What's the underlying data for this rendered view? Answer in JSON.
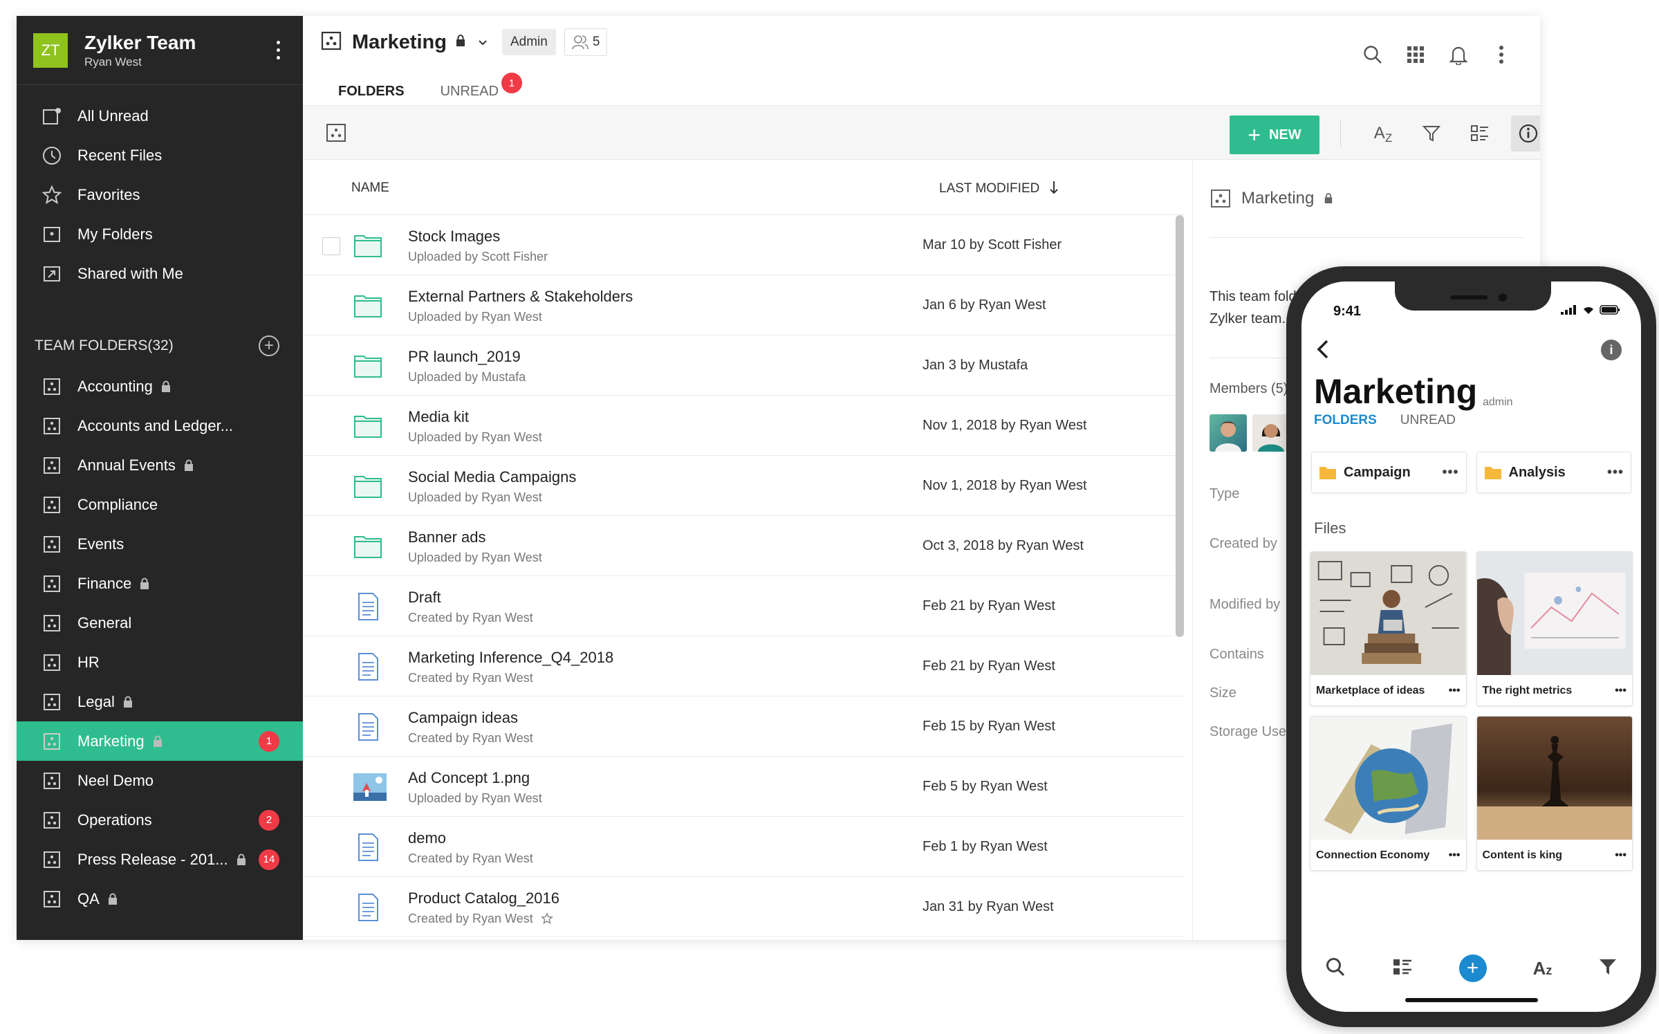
{
  "sidebar": {
    "avatar_initials": "ZT",
    "team_name": "Zylker Team",
    "user_name": "Ryan West",
    "nav": [
      {
        "label": "All Unread",
        "icon": "all-unread-icon"
      },
      {
        "label": "Recent Files",
        "icon": "clock-icon"
      },
      {
        "label": "Favorites",
        "icon": "star-icon"
      },
      {
        "label": "My Folders",
        "icon": "my-folders-icon"
      },
      {
        "label": "Shared with Me",
        "icon": "shared-icon"
      }
    ],
    "team_folders_label": "TEAM FOLDERS",
    "team_folders_count": "(32)",
    "team_folders": [
      {
        "label": "Accounting",
        "locked": true,
        "badge": ""
      },
      {
        "label": "Accounts and Ledger...",
        "locked": false,
        "badge": ""
      },
      {
        "label": "Annual Events",
        "locked": true,
        "badge": ""
      },
      {
        "label": "Compliance",
        "locked": false,
        "badge": ""
      },
      {
        "label": "Events",
        "locked": false,
        "badge": ""
      },
      {
        "label": "Finance",
        "locked": true,
        "badge": ""
      },
      {
        "label": "General",
        "locked": false,
        "badge": ""
      },
      {
        "label": "HR",
        "locked": false,
        "badge": ""
      },
      {
        "label": "Legal",
        "locked": true,
        "badge": ""
      },
      {
        "label": "Marketing",
        "locked": true,
        "badge": "1",
        "active": true
      },
      {
        "label": "Neel Demo",
        "locked": false,
        "badge": ""
      },
      {
        "label": "Operations",
        "locked": false,
        "badge": "2"
      },
      {
        "label": "Press Release - 201...",
        "locked": true,
        "badge": "14"
      },
      {
        "label": "QA",
        "locked": true,
        "badge": ""
      }
    ]
  },
  "header": {
    "title": "Marketing",
    "role": "Admin",
    "members_count": "5",
    "tabs": [
      {
        "label": "FOLDERS",
        "selected": true,
        "badge": ""
      },
      {
        "label": "UNREAD",
        "selected": false,
        "badge": "1"
      }
    ]
  },
  "toolbar": {
    "new_label": "NEW",
    "sort_label": "A",
    "sort_sub": "Z"
  },
  "list": {
    "col_name": "NAME",
    "col_modified": "LAST MODIFIED",
    "rows": [
      {
        "type": "folder",
        "name": "Stock Images",
        "sub": "Uploaded by Scott Fisher",
        "modified": "Mar 10 by Scott Fisher"
      },
      {
        "type": "folder",
        "name": "External Partners & Stakeholders",
        "sub": "Uploaded by Ryan West",
        "modified": "Jan 6 by Ryan West"
      },
      {
        "type": "folder",
        "name": "PR launch_2019",
        "sub": "Uploaded by Mustafa",
        "modified": "Jan 3 by Mustafa"
      },
      {
        "type": "folder",
        "name": "Media kit",
        "sub": "Uploaded by Ryan West",
        "modified": "Nov 1, 2018 by Ryan West"
      },
      {
        "type": "folder",
        "name": "Social Media Campaigns",
        "sub": "Uploaded by Ryan West",
        "modified": "Nov 1, 2018 by Ryan West"
      },
      {
        "type": "folder",
        "name": "Banner ads",
        "sub": "Uploaded by Ryan West",
        "modified": "Oct 3, 2018 by Ryan West"
      },
      {
        "type": "doc",
        "name": "Draft",
        "sub": "Created by Ryan West",
        "modified": "Feb 21 by Ryan West"
      },
      {
        "type": "doc",
        "name": "Marketing Inference_Q4_2018",
        "sub": "Created by Ryan West",
        "modified": "Feb 21 by Ryan West"
      },
      {
        "type": "doc",
        "name": "Campaign ideas",
        "sub": "Created by Ryan West",
        "modified": "Feb 15 by Ryan West"
      },
      {
        "type": "image",
        "name": "Ad Concept 1.png",
        "sub": "Uploaded by Ryan West",
        "modified": "Feb 5 by Ryan West"
      },
      {
        "type": "doc",
        "name": "demo",
        "sub": "Created by Ryan West",
        "modified": "Feb 1 by Ryan West"
      },
      {
        "type": "doc",
        "name": "Product Catalog_2016",
        "sub": "Created by Ryan West",
        "modified": "Jan 31 by Ryan West"
      }
    ]
  },
  "details": {
    "title": "Marketing",
    "description": "This team folder i",
    "description_2": "Zylker team.",
    "members_label": "Members (5)",
    "labels": [
      "Type",
      "Created by",
      "Modified by",
      "Contains",
      "Size",
      "Storage Used"
    ]
  },
  "phone": {
    "time": "9:41",
    "title": "Marketing",
    "role": "admin",
    "tabs": [
      "FOLDERS",
      "UNREAD"
    ],
    "folders": [
      "Campaign",
      "Analysis"
    ],
    "files_label": "Files",
    "files": [
      "Marketplace of ideas",
      "The right metrics",
      "Connection Economy",
      "Content is king"
    ]
  },
  "colors": {
    "accent": "#2fbd8f",
    "sidebar_bg": "#262626",
    "badge": "#f03a46",
    "phone_accent": "#1b8ad0",
    "avatar": "#8fc31f"
  }
}
